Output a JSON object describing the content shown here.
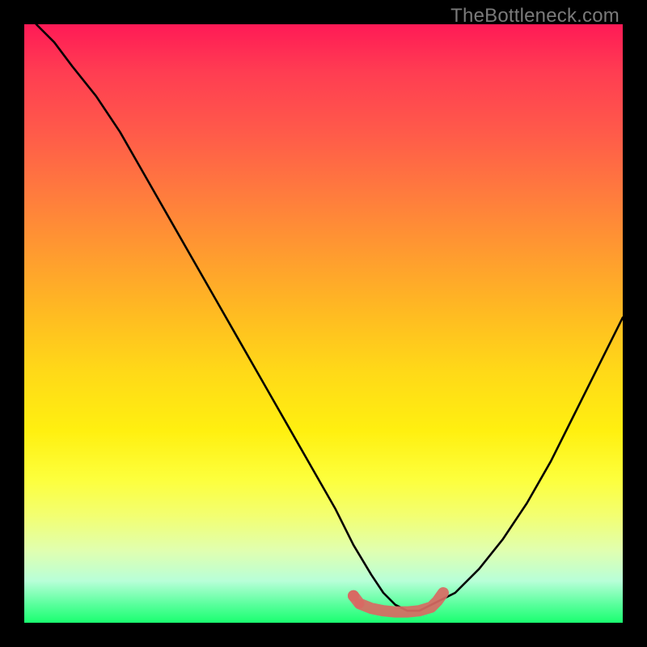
{
  "watermark": "TheBottleneck.com",
  "chart_data": {
    "type": "line",
    "title": "",
    "xlabel": "",
    "ylabel": "",
    "xlim": [
      0,
      100
    ],
    "ylim": [
      0,
      100
    ],
    "grid": false,
    "legend": false,
    "series": [
      {
        "name": "bottleneck-curve",
        "color": "#000000",
        "x": [
          2,
          5,
          8,
          12,
          16,
          20,
          24,
          28,
          32,
          36,
          40,
          44,
          48,
          52,
          55,
          58,
          60,
          62,
          64,
          66,
          68,
          72,
          76,
          80,
          84,
          88,
          92,
          96,
          100
        ],
        "y": [
          100,
          97,
          93,
          88,
          82,
          75,
          68,
          61,
          54,
          47,
          40,
          33,
          26,
          19,
          13,
          8,
          5,
          3,
          2,
          2,
          3,
          5,
          9,
          14,
          20,
          27,
          35,
          43,
          51
        ]
      },
      {
        "name": "valley-marker",
        "color": "#d86a63",
        "x": [
          55,
          56,
          58,
          60,
          62,
          64,
          66,
          68,
          69,
          70
        ],
        "y": [
          4.5,
          3.2,
          2.4,
          2.0,
          1.8,
          1.8,
          2.0,
          2.6,
          3.6,
          5.0
        ]
      }
    ],
    "background_gradient": {
      "top": "#ff1a56",
      "mid": "#ffd918",
      "bottom": "#1aff70"
    }
  }
}
